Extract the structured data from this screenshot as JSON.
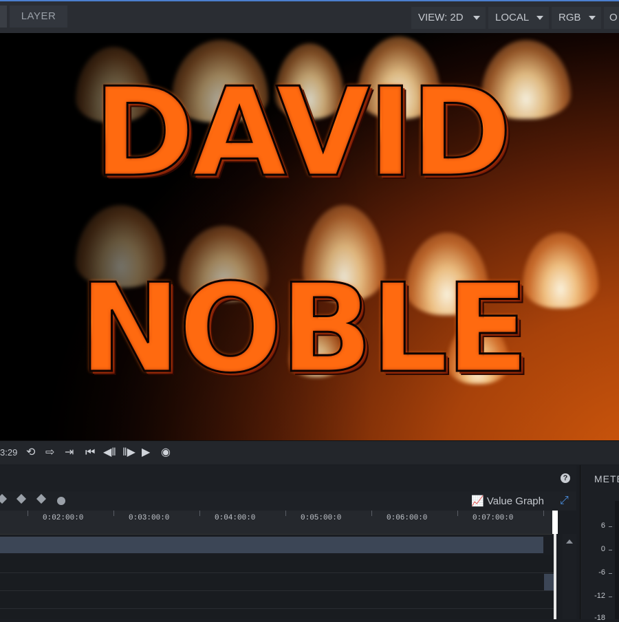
{
  "toolbar": {
    "tab_label": "LAYER",
    "view_label": "VIEW: 2D",
    "space_label": "LOCAL",
    "channel_label": "RGB",
    "cut_label": "O"
  },
  "viewer": {
    "title_line1": "DAVID",
    "title_line2": "NOBLE"
  },
  "transport": {
    "timecode": "3:29",
    "icons": [
      "loop-icon",
      "export-icon",
      "import-icon",
      "go-to-start-icon",
      "step-back-icon",
      "step-forward-icon",
      "play-icon",
      "record-icon"
    ]
  },
  "timeline": {
    "value_graph_label": "Value Graph",
    "ruler_labels": [
      "0:02:00:0",
      "0:03:00:0",
      "0:04:00:0",
      "0:05:00:0",
      "0:06:00:0",
      "0:07:00:0"
    ]
  },
  "meters": {
    "title": "METE",
    "labels": [
      "6",
      "0",
      "-6",
      "-12",
      "-18"
    ]
  },
  "colors": {
    "accent": "#4b7fcf",
    "track": "#3c4656",
    "fire_orange": "#d2590c"
  }
}
